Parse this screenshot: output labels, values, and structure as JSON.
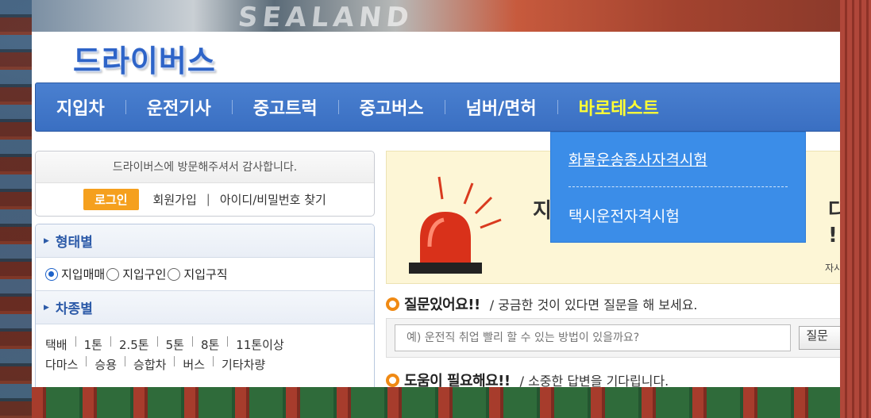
{
  "site": {
    "logo": "드라이버스"
  },
  "background": {
    "container_text": "SEALAND"
  },
  "nav": {
    "items": [
      {
        "label": "지입차"
      },
      {
        "label": "운전기사"
      },
      {
        "label": "중고트럭"
      },
      {
        "label": "중고버스"
      },
      {
        "label": "넘버/면허"
      },
      {
        "label": "바로테스트",
        "active": true
      }
    ],
    "dropdown": [
      {
        "label": "화물운송종사자격시험"
      },
      {
        "label": "택시운전자격시험"
      }
    ]
  },
  "login": {
    "welcome": "드라이버스에 방문해주셔서 감사합니다.",
    "login_button": "로그인",
    "signup": "회원가입",
    "find_account": "아이디/비밀번호 찾기"
  },
  "filters": {
    "by_type": {
      "title": "형태별",
      "options": [
        "지입매매",
        "지입구인",
        "지입구직"
      ],
      "selected": "지입매매"
    },
    "by_vehicle": {
      "title": "차종별",
      "row1": [
        "택배",
        "1톤",
        "2.5톤",
        "5톤",
        "8톤",
        "11톤이상"
      ],
      "row2": [
        "다마스",
        "승용",
        "승합차",
        "버스",
        "기타차량"
      ]
    }
  },
  "banner": {
    "heading_left": "지",
    "heading_right": "다 !",
    "sub_right": "자시"
  },
  "qa": {
    "ask_title": "질문있어요!!",
    "ask_sub": "/ 궁금한 것이 있다면 질문을 해 보세요.",
    "ask_placeholder": "예) 운전직 취업 빨리 할 수 있는 방법이 있을까요?",
    "ask_button": "질문",
    "help_title": "도움이 필요해요!!",
    "help_sub": "/ 소중한 답변을 기다립니다."
  },
  "colors": {
    "nav_bg": "#3a6fc2",
    "nav_active": "#ffff33",
    "dropdown_bg": "#3b8de8",
    "login_button": "#f5a01e",
    "accent_ring": "#f08a14",
    "banner_bg": "#fdf6d6"
  },
  "icons": [
    "alarm-siren-icon",
    "triangle-right-icon",
    "radio-icon",
    "orange-ring-icon"
  ]
}
